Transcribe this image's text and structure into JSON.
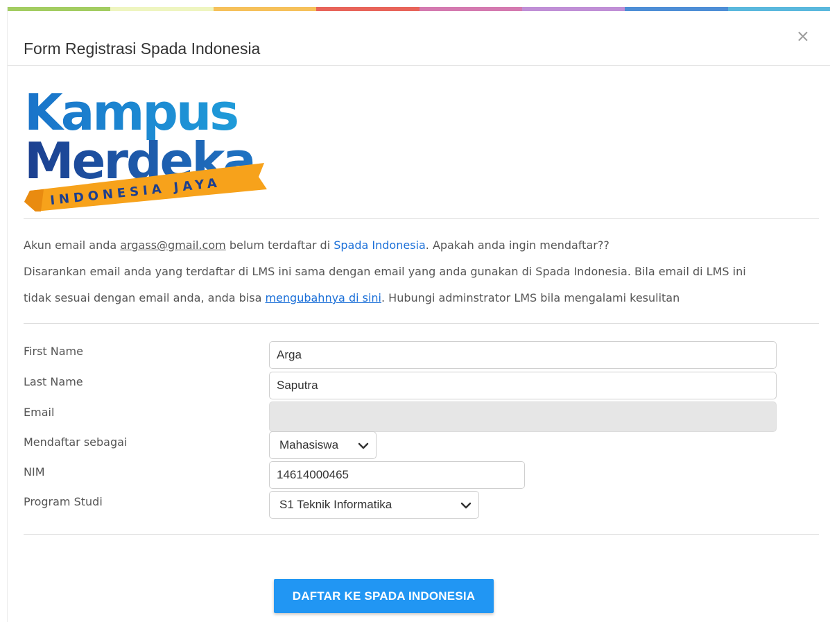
{
  "modal": {
    "title": "Form Registrasi Spada Indonesia",
    "close_icon": "×"
  },
  "colors": {
    "rainbow": [
      "#a3cd62",
      "#eef5c0",
      "#f6c15b",
      "#e8645a",
      "#d47ab0",
      "#c08fd6",
      "#4e8ed6",
      "#5ab8dd"
    ],
    "link": "#1a6fd8",
    "button": "#2196f3",
    "logo_blue": "#1f5fae",
    "logo_ribbon": "#f7a21b"
  },
  "logo": {
    "line1": "Kampus",
    "line2": "Merdeka",
    "ribbon": "INDONESIA JAYA"
  },
  "message": {
    "line1_prefix": "Akun email anda ",
    "email": "argass@gmail.com",
    "line1_mid": " belum terdaftar di ",
    "spada_link": "Spada Indonesia",
    "line1_suffix": ". Apakah anda ingin mendaftar??",
    "line2": "Disarankan email anda yang terdaftar di LMS ini sama dengan email yang anda gunakan di Spada Indonesia. Bila email di LMS ini",
    "line3_prefix": "tidak sesuai dengan email anda, anda bisa ",
    "change_link": "mengubahnya di sini",
    "line3_suffix": ". Hubungi adminstrator LMS bila mengalami kesulitan"
  },
  "form": {
    "first_name": {
      "label": "First Name",
      "value": "Arga"
    },
    "last_name": {
      "label": "Last Name",
      "value": "Saputra"
    },
    "email": {
      "label": "Email",
      "value": ""
    },
    "role": {
      "label": "Mendaftar sebagai",
      "value": "Mahasiswa"
    },
    "nim": {
      "label": "NIM",
      "value": "14614000465"
    },
    "program": {
      "label": "Program Studi",
      "value": "S1 Teknik Informatika"
    }
  },
  "submit_label": "DAFTAR KE SPADA INDONESIA"
}
